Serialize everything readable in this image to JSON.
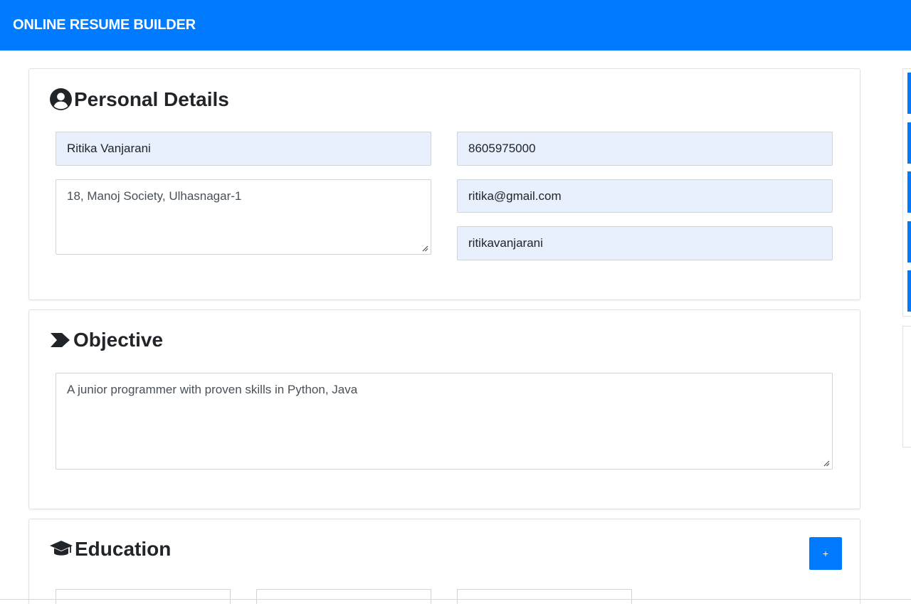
{
  "navbar": {
    "brand": "ONLINE RESUME BUILDER"
  },
  "personal": {
    "title": "Personal Details",
    "icon": "user-circle-icon",
    "name": "Ritika Vanjarani",
    "phone": "8605975000",
    "address": "18, Manoj Society, Ulhasnagar-1",
    "email": "ritika@gmail.com",
    "username": "ritikavanjarani"
  },
  "objective": {
    "title": "Objective",
    "icon": "chevron-right-icon",
    "text": "A junior programmer with proven skills in Python, Java"
  },
  "education": {
    "title": "Education",
    "icon": "graduation-cap-icon",
    "add_label": "+"
  },
  "colors": {
    "primary": "#007bff",
    "autofill": "#e8f0fe"
  }
}
